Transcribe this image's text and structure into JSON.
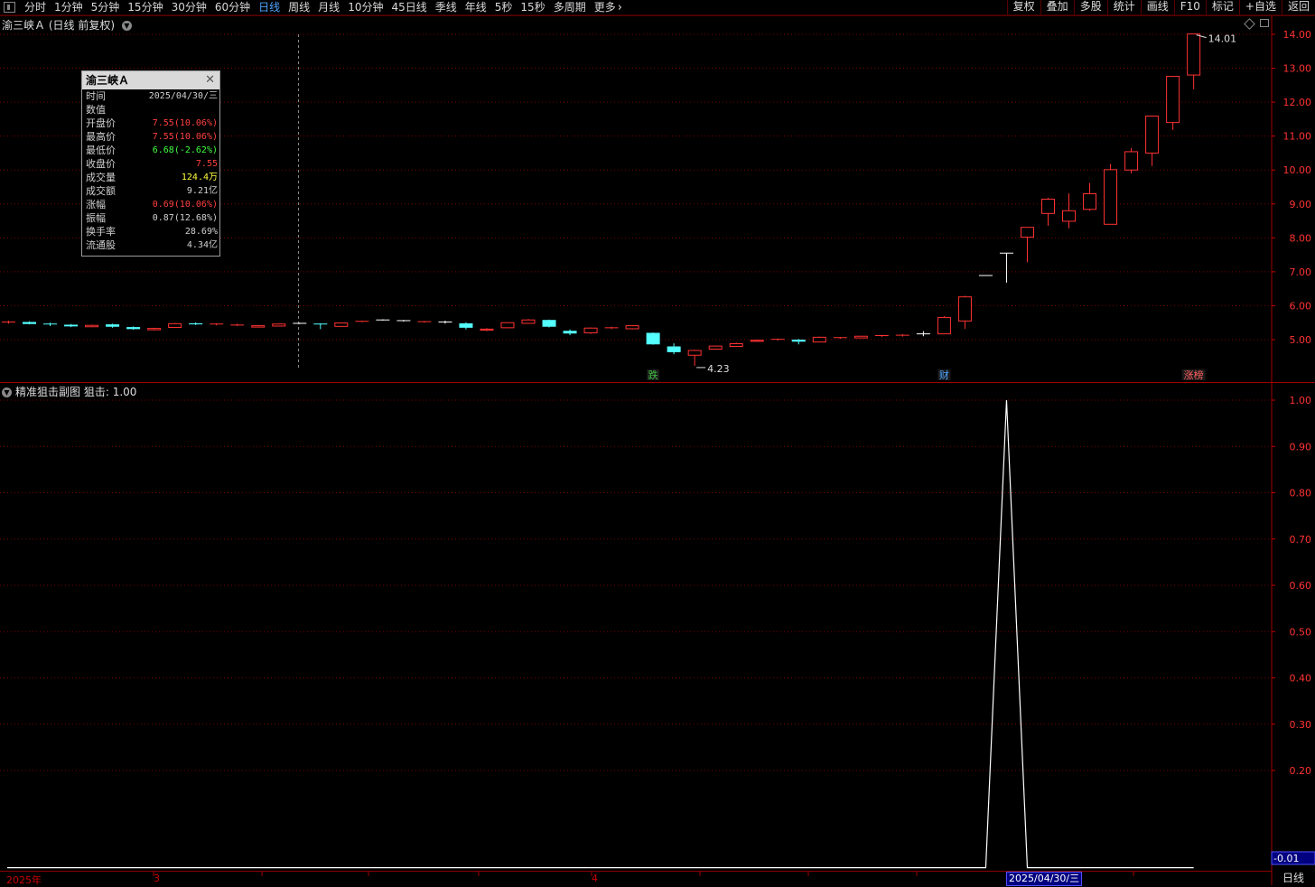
{
  "toolbar": {
    "period_tabs": [
      {
        "label": "分时"
      },
      {
        "label": "1分钟"
      },
      {
        "label": "5分钟"
      },
      {
        "label": "15分钟"
      },
      {
        "label": "30分钟"
      },
      {
        "label": "60分钟"
      },
      {
        "label": "日线",
        "active": true
      },
      {
        "label": "周线"
      },
      {
        "label": "月线"
      },
      {
        "label": "10分钟"
      },
      {
        "label": "45日线"
      },
      {
        "label": "季线"
      },
      {
        "label": "年线"
      },
      {
        "label": "5秒"
      },
      {
        "label": "15秒"
      },
      {
        "label": "多周期"
      },
      {
        "label": "更多"
      }
    ],
    "right_buttons": [
      {
        "label": "复权"
      },
      {
        "label": "叠加"
      },
      {
        "label": "多股"
      },
      {
        "label": "统计"
      },
      {
        "label": "画线"
      },
      {
        "label": "F10"
      },
      {
        "label": "标记"
      },
      {
        "label": "+自选"
      },
      {
        "label": "返回"
      }
    ]
  },
  "chart": {
    "stock_name": "渝三峡Ａ",
    "mode": "(日线 前复权)",
    "period_footer": "日线"
  },
  "info_box": {
    "title": "渝三峡Ａ",
    "rows": [
      {
        "label": "时间",
        "value": "2025/04/30/三",
        "color": "#d0d0d0"
      },
      {
        "label": "数值",
        "value": "",
        "color": "#d0d0d0"
      },
      {
        "label": "开盘价",
        "value": "7.55(10.06%)",
        "color": "#ff4040"
      },
      {
        "label": "最高价",
        "value": "7.55(10.06%)",
        "color": "#ff4040"
      },
      {
        "label": "最低价",
        "value": "6.68(-2.62%)",
        "color": "#40ff40"
      },
      {
        "label": "收盘价",
        "value": "7.55",
        "color": "#ff4040"
      },
      {
        "label": "成交量",
        "value": "124.4万",
        "color": "#ffff40"
      },
      {
        "label": "成交额",
        "value": "9.21亿",
        "color": "#d0d0d0"
      },
      {
        "label": "涨幅",
        "value": "0.69(10.06%)",
        "color": "#ff4040"
      },
      {
        "label": "振幅",
        "value": "0.87(12.68%)",
        "color": "#d0d0d0"
      },
      {
        "label": "换手率",
        "value": "28.69%",
        "color": "#d0d0d0"
      },
      {
        "label": "流通股",
        "value": "4.34亿",
        "color": "#d0d0d0"
      }
    ]
  },
  "indicator": {
    "name": "精准狙击副图",
    "line_label": "狙击: 1.00",
    "current_value": "-0.01"
  },
  "price_axis_labels": [
    "14.00",
    "13.00",
    "12.00",
    "11.00",
    "10.00",
    "9.00",
    "8.00",
    "7.00",
    "6.00",
    "5.00"
  ],
  "indicator_axis_labels": [
    "1.00",
    "0.90",
    "0.80",
    "0.70",
    "0.60",
    "0.50",
    "0.40",
    "0.30",
    "0.20"
  ],
  "annotations": {
    "high_label": "14.01",
    "low_label": "4.23",
    "markers": [
      {
        "text": "跌",
        "color": "#40c040"
      },
      {
        "text": "财",
        "color": "#4ea3ff"
      },
      {
        "text": "涨榜",
        "color": "#ff6060"
      }
    ]
  },
  "date_bar": {
    "labels": [
      "2025年",
      "3",
      "4"
    ],
    "cursor_date": "2025/04/30/三"
  },
  "colors": {
    "up": "#ff3232",
    "down": "#54ffff",
    "flat": "#ffffff",
    "grid": "#7a0000",
    "axis_text": "#ff3232",
    "indicator_line": "#ffffff"
  },
  "chart_data": {
    "type": "candlestick",
    "price_range": [
      4.0,
      14.4
    ],
    "indicator_range": [
      -0.01,
      1.0
    ],
    "candles": [
      {
        "o": 5.5,
        "h": 5.56,
        "l": 5.47,
        "c": 5.52
      },
      {
        "o": 5.52,
        "h": 5.54,
        "l": 5.45,
        "c": 5.46
      },
      {
        "o": 5.46,
        "h": 5.5,
        "l": 5.4,
        "c": 5.44
      },
      {
        "o": 5.44,
        "h": 5.46,
        "l": 5.37,
        "c": 5.39
      },
      {
        "o": 5.38,
        "h": 5.44,
        "l": 5.37,
        "c": 5.42
      },
      {
        "o": 5.45,
        "h": 5.47,
        "l": 5.35,
        "c": 5.38
      },
      {
        "o": 5.37,
        "h": 5.39,
        "l": 5.29,
        "c": 5.31
      },
      {
        "o": 5.29,
        "h": 5.35,
        "l": 5.27,
        "c": 5.33
      },
      {
        "o": 5.36,
        "h": 5.49,
        "l": 5.35,
        "c": 5.47
      },
      {
        "o": 5.48,
        "h": 5.51,
        "l": 5.43,
        "c": 5.45
      },
      {
        "o": 5.44,
        "h": 5.48,
        "l": 5.42,
        "c": 5.46
      },
      {
        "o": 5.42,
        "h": 5.47,
        "l": 5.4,
        "c": 5.43
      },
      {
        "o": 5.37,
        "h": 5.43,
        "l": 5.36,
        "c": 5.41
      },
      {
        "o": 5.4,
        "h": 5.47,
        "l": 5.39,
        "c": 5.46
      },
      {
        "o": 5.48,
        "h": 5.5,
        "l": 5.46,
        "c": 5.48
      },
      {
        "o": 5.46,
        "h": 5.48,
        "l": 5.31,
        "c": 5.44
      },
      {
        "o": 5.39,
        "h": 5.51,
        "l": 5.38,
        "c": 5.49
      },
      {
        "o": 5.52,
        "h": 5.55,
        "l": 5.51,
        "c": 5.54
      },
      {
        "o": 5.58,
        "h": 5.6,
        "l": 5.56,
        "c": 5.58
      },
      {
        "o": 5.56,
        "h": 5.58,
        "l": 5.53,
        "c": 5.56
      },
      {
        "o": 5.52,
        "h": 5.55,
        "l": 5.5,
        "c": 5.53
      },
      {
        "o": 5.52,
        "h": 5.56,
        "l": 5.47,
        "c": 5.52
      },
      {
        "o": 5.48,
        "h": 5.51,
        "l": 5.3,
        "c": 5.35
      },
      {
        "o": 5.28,
        "h": 5.34,
        "l": 5.25,
        "c": 5.31
      },
      {
        "o": 5.35,
        "h": 5.51,
        "l": 5.34,
        "c": 5.5
      },
      {
        "o": 5.48,
        "h": 5.61,
        "l": 5.47,
        "c": 5.58
      },
      {
        "o": 5.58,
        "h": 5.59,
        "l": 5.36,
        "c": 5.38
      },
      {
        "o": 5.26,
        "h": 5.3,
        "l": 5.13,
        "c": 5.18
      },
      {
        "o": 5.2,
        "h": 5.36,
        "l": 5.17,
        "c": 5.34
      },
      {
        "o": 5.34,
        "h": 5.38,
        "l": 5.31,
        "c": 5.35
      },
      {
        "o": 5.32,
        "h": 5.42,
        "l": 5.3,
        "c": 5.41
      },
      {
        "o": 5.2,
        "h": 5.21,
        "l": 4.85,
        "c": 4.86
      },
      {
        "o": 4.8,
        "h": 4.89,
        "l": 4.57,
        "c": 4.63
      },
      {
        "o": 4.54,
        "h": 4.7,
        "l": 4.23,
        "c": 4.68
      },
      {
        "o": 4.72,
        "h": 4.82,
        "l": 4.7,
        "c": 4.81
      },
      {
        "o": 4.8,
        "h": 4.91,
        "l": 4.79,
        "c": 4.88
      },
      {
        "o": 4.95,
        "h": 5.0,
        "l": 4.94,
        "c": 4.98
      },
      {
        "o": 4.99,
        "h": 5.03,
        "l": 4.97,
        "c": 5.01
      },
      {
        "o": 5.0,
        "h": 5.02,
        "l": 4.86,
        "c": 4.94
      },
      {
        "o": 4.93,
        "h": 5.09,
        "l": 4.92,
        "c": 5.07
      },
      {
        "o": 5.05,
        "h": 5.08,
        "l": 5.02,
        "c": 5.06
      },
      {
        "o": 5.05,
        "h": 5.11,
        "l": 5.04,
        "c": 5.1
      },
      {
        "o": 5.1,
        "h": 5.14,
        "l": 5.08,
        "c": 5.12
      },
      {
        "o": 5.12,
        "h": 5.16,
        "l": 5.09,
        "c": 5.13
      },
      {
        "o": 5.17,
        "h": 5.25,
        "l": 5.1,
        "c": 5.17
      },
      {
        "o": 5.17,
        "h": 5.69,
        "l": 5.16,
        "c": 5.65
      },
      {
        "o": 5.55,
        "h": 6.29,
        "l": 5.32,
        "c": 6.26
      },
      {
        "o": 6.89,
        "h": 6.89,
        "l": 6.89,
        "c": 6.89
      },
      {
        "o": 7.55,
        "h": 7.55,
        "l": 6.68,
        "c": 7.55
      },
      {
        "o": 8.02,
        "h": 8.3,
        "l": 7.28,
        "c": 8.31
      },
      {
        "o": 8.72,
        "h": 9.18,
        "l": 8.36,
        "c": 9.14
      },
      {
        "o": 8.49,
        "h": 9.31,
        "l": 8.28,
        "c": 8.8
      },
      {
        "o": 8.84,
        "h": 9.62,
        "l": 8.8,
        "c": 9.3
      },
      {
        "o": 8.4,
        "h": 10.18,
        "l": 8.4,
        "c": 10.01
      },
      {
        "o": 10.0,
        "h": 10.65,
        "l": 9.9,
        "c": 10.54
      },
      {
        "o": 10.5,
        "h": 11.6,
        "l": 10.12,
        "c": 11.59
      },
      {
        "o": 11.4,
        "h": 12.76,
        "l": 11.18,
        "c": 12.76
      },
      {
        "o": 12.8,
        "h": 14.01,
        "l": 12.38,
        "c": 14.01
      }
    ],
    "indicator_series": {
      "name": "狙击",
      "values_by_candle": {
        "48": 1.0
      },
      "default": -0.01
    }
  }
}
